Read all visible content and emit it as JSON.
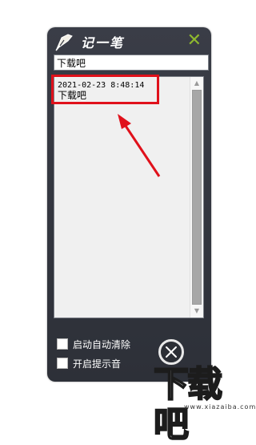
{
  "app": {
    "title": "记一笔",
    "title_input_value": "下载吧"
  },
  "notes": [
    {
      "timestamp": "2021-02-23 8:48:14",
      "text": "下载吧"
    }
  ],
  "options": {
    "auto_clear_label": "启动自动清除",
    "auto_clear_checked": false,
    "sound_label": "开启提示音",
    "sound_checked": false
  },
  "icons": {
    "app_logo": "pen-icon",
    "close_top": "close-x-icon",
    "close_bottom": "close-circle-icon",
    "scroll_up": "triangle-up-icon",
    "scroll_down": "triangle-down-icon"
  },
  "colors": {
    "panel": "#353841",
    "accent_close": "#8fb92e",
    "annotation": "#e0111b"
  },
  "watermark": {
    "text": "下载吧",
    "url": "www.xiazaiba.com"
  }
}
